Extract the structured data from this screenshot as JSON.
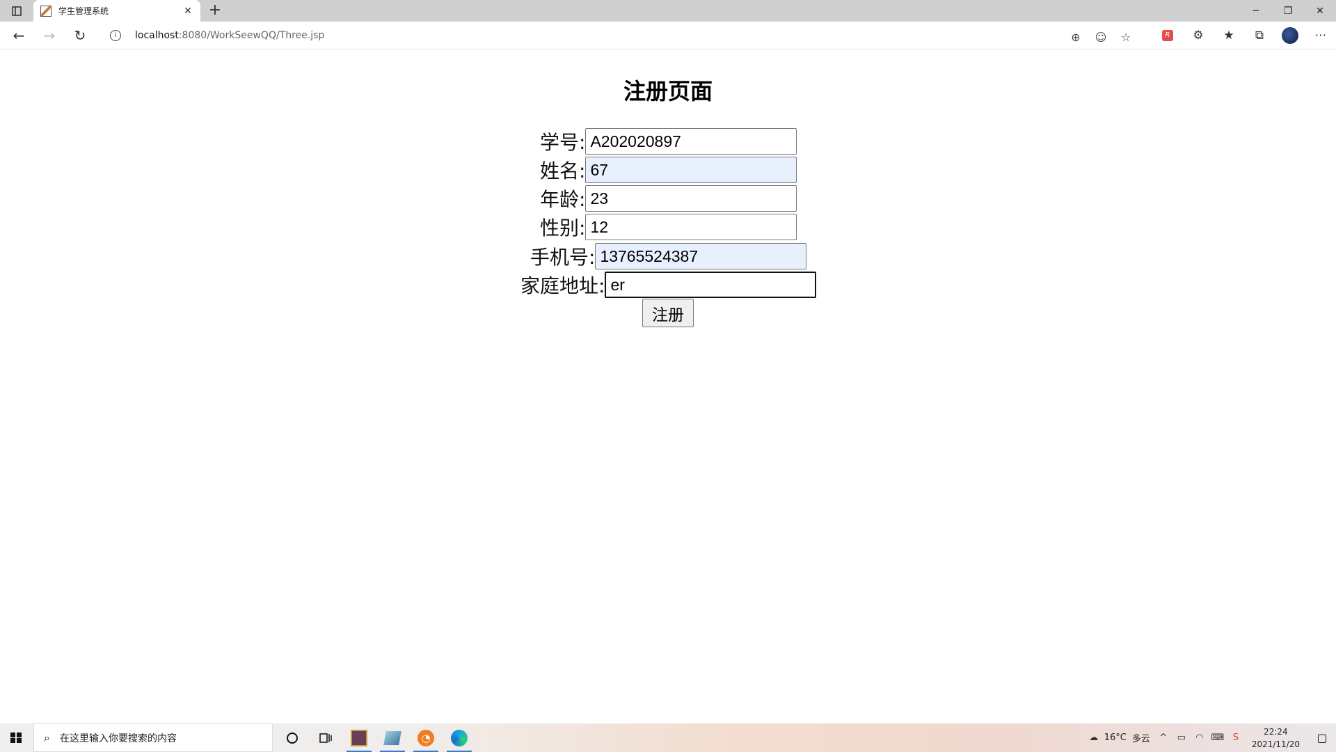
{
  "browser": {
    "tab_title": "学生管理系统",
    "url_host": "localhost",
    "url_path": ":8080/WorkSeewQQ/Three.jsp"
  },
  "page": {
    "heading": "注册页面",
    "fields": [
      {
        "label": "学号:",
        "value": "A202020897"
      },
      {
        "label": "姓名:",
        "value": "67"
      },
      {
        "label": "年龄:",
        "value": "23"
      },
      {
        "label": "性别:",
        "value": "12"
      },
      {
        "label": "手机号:",
        "value": "13765524387"
      },
      {
        "label": "家庭地址:",
        "value": "er"
      }
    ],
    "submit_label": "注册"
  },
  "taskbar": {
    "search_placeholder": "在这里输入你要搜索的内容",
    "weather_temp": "16°C",
    "weather_desc": "多云",
    "time": "22:24",
    "date": "2021/11/20"
  }
}
